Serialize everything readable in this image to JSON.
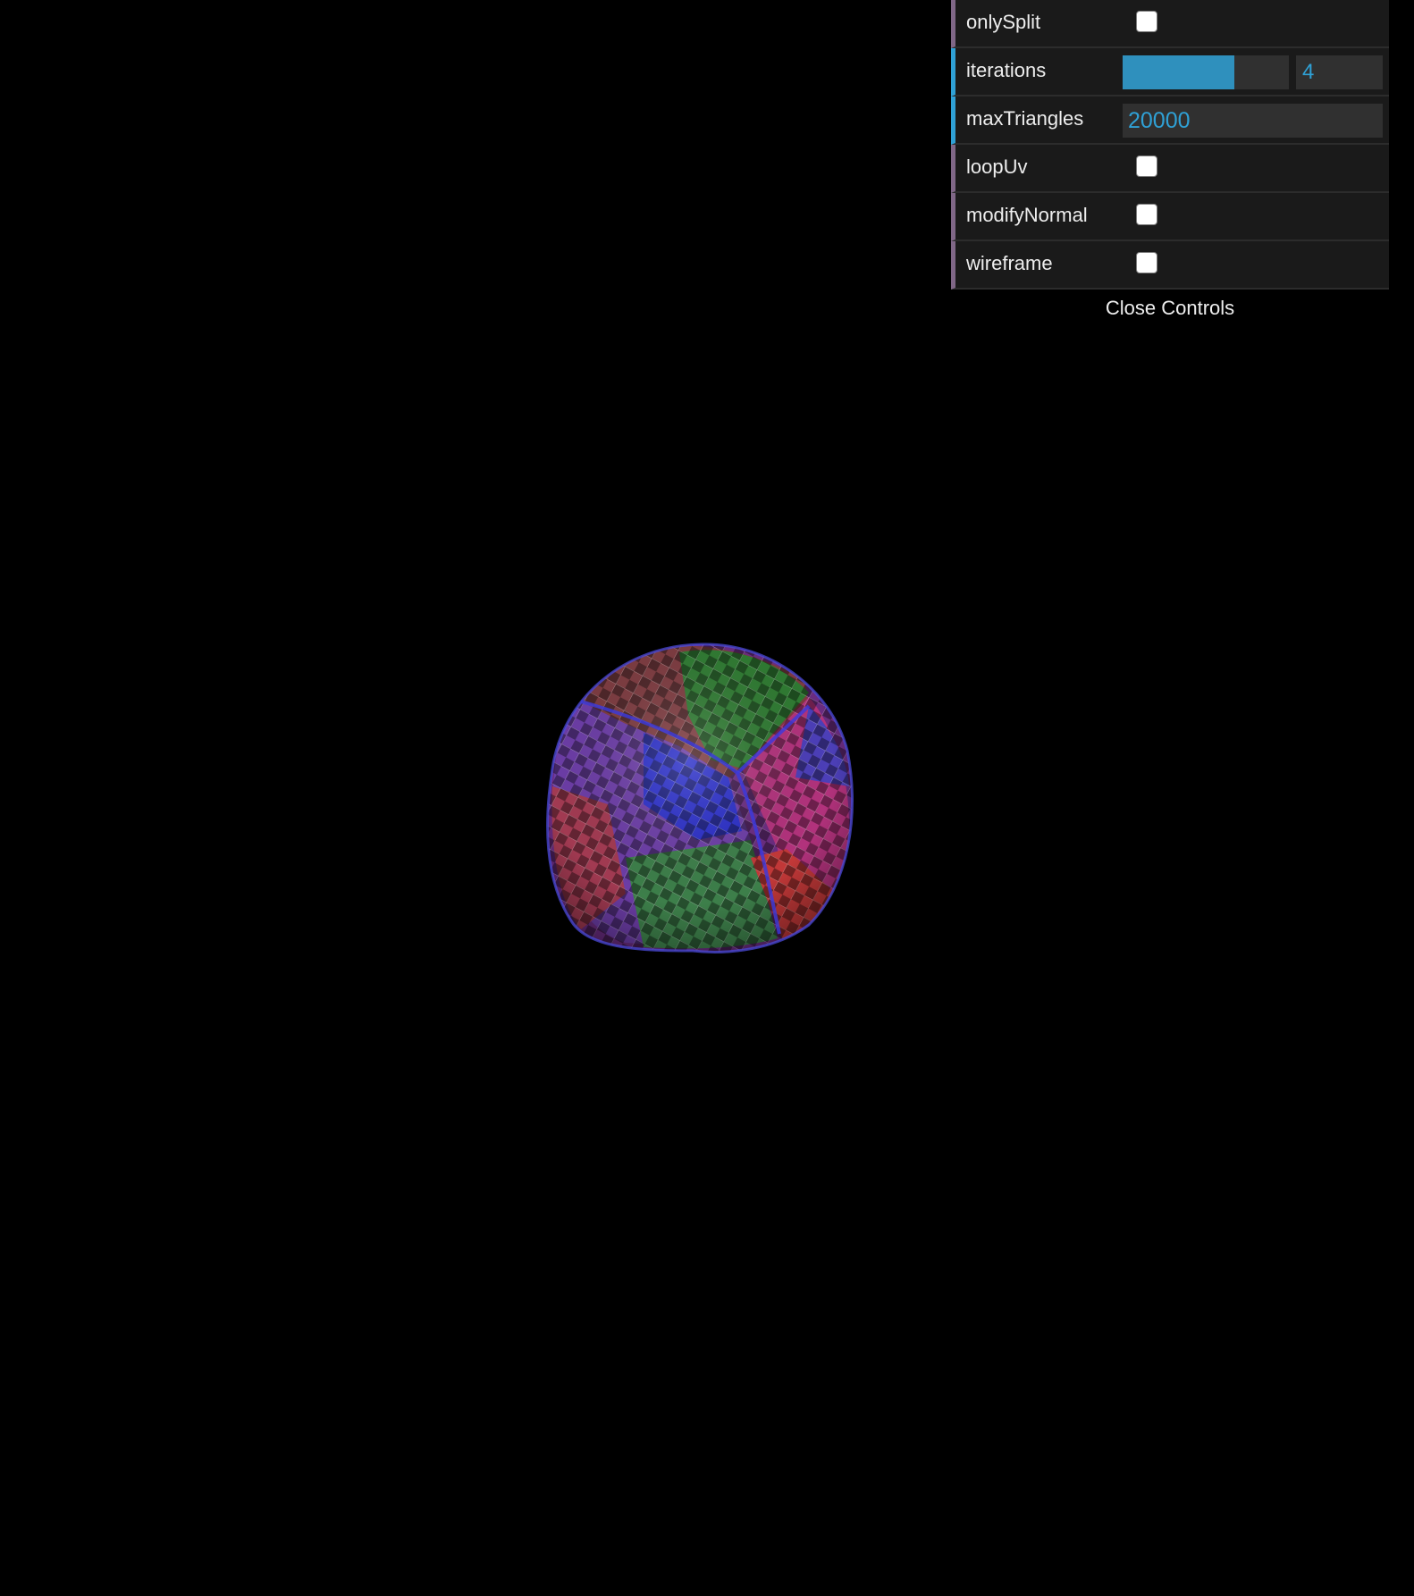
{
  "gui": {
    "controls": [
      {
        "label": "onlySplit",
        "type": "checkbox",
        "checked": false
      },
      {
        "label": "iterations",
        "type": "slider",
        "value": "4",
        "fill_fraction": 0.67
      },
      {
        "label": "maxTriangles",
        "type": "text",
        "value": "20000"
      },
      {
        "label": "loopUv",
        "type": "checkbox",
        "checked": false
      },
      {
        "label": "modifyNormal",
        "type": "checkbox",
        "checked": false
      },
      {
        "label": "wireframe",
        "type": "checkbox",
        "checked": false
      }
    ],
    "close_label": "Close Controls"
  },
  "colors": {
    "background": "#000000",
    "panel": "#1a1a1a",
    "accent": "#2fa1d6",
    "boolean_accent": "#806787",
    "sphere_red": "#d8333a",
    "sphere_green": "#3a9e35",
    "sphere_blue": "#2a2fd6",
    "sphere_magenta": "#b02fc4"
  }
}
